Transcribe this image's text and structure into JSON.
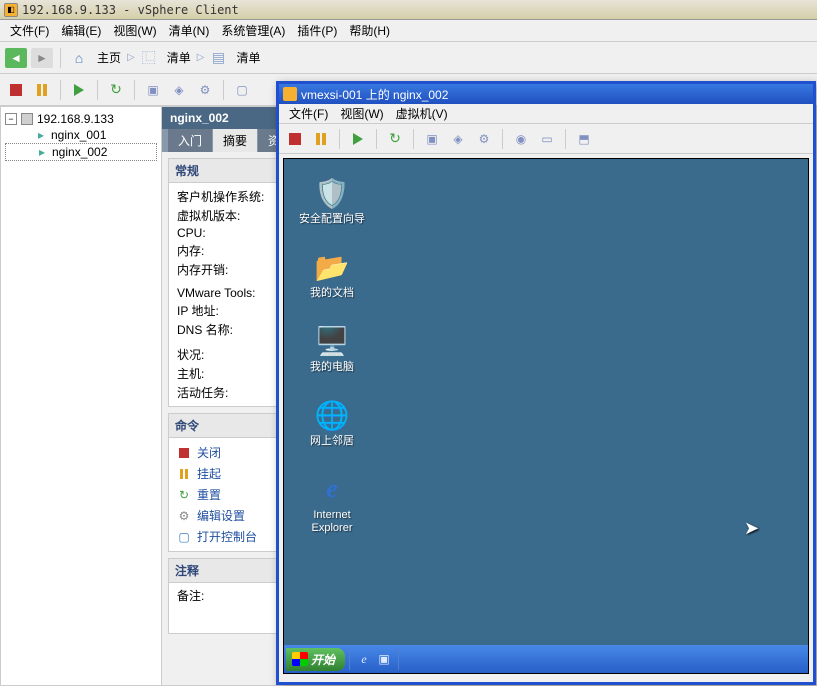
{
  "window": {
    "title": "192.168.9.133 - vSphere Client"
  },
  "menubar": [
    "文件(F)",
    "编辑(E)",
    "视图(W)",
    "清单(N)",
    "系统管理(A)",
    "插件(P)",
    "帮助(H)"
  ],
  "nav": {
    "home": "主页",
    "inventory1": "清单",
    "inventory2": "清单"
  },
  "tree": {
    "root": "192.168.9.133",
    "nodes": [
      "nginx_001",
      "nginx_002"
    ]
  },
  "detail": {
    "title": "nginx_002",
    "tabs": [
      "入门",
      "摘要",
      "资源"
    ],
    "general": {
      "title": "常规",
      "rows": [
        "客户机操作系统:",
        "虚拟机版本:",
        "CPU:",
        "内存:",
        "内存开销:",
        "VMware Tools:",
        "IP 地址:",
        "DNS 名称:",
        "状况:",
        "主机:",
        "活动任务:"
      ]
    },
    "commands": {
      "title": "命令",
      "items": [
        "关闭",
        "挂起",
        "重置",
        "编辑设置",
        "打开控制台"
      ]
    },
    "notes": {
      "title": "注释",
      "label": "备注:"
    }
  },
  "console": {
    "title": "vmexsi-001 上的 nginx_002",
    "menu": [
      "文件(F)",
      "视图(W)",
      "虚拟机(V)"
    ],
    "desktop_icons": [
      {
        "label": "安全配置向导"
      },
      {
        "label": "我的文档"
      },
      {
        "label": "我的电脑"
      },
      {
        "label": "网上邻居"
      },
      {
        "label": "Internet\nExplorer"
      }
    ],
    "taskbar": {
      "start": "开始"
    }
  }
}
